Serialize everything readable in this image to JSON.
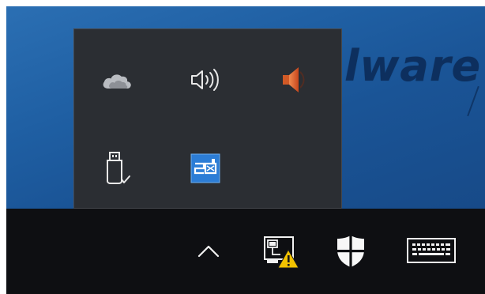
{
  "wallpaper": {
    "text": "lware"
  },
  "overflow_panel": {
    "icons": [
      {
        "name": "onedrive-cloud-icon",
        "row": 0,
        "col": 0
      },
      {
        "name": "speaker-volume-icon",
        "row": 0,
        "col": 1
      },
      {
        "name": "audio-app-speaker-icon",
        "row": 0,
        "col": 2
      },
      {
        "name": "usb-safely-remove-icon",
        "row": 1,
        "col": 0
      },
      {
        "name": "network-adapter-app-icon",
        "row": 1,
        "col": 1
      }
    ]
  },
  "taskbar": {
    "icons": [
      {
        "name": "show-hidden-icons-chevron-icon"
      },
      {
        "name": "network-warning-icon"
      },
      {
        "name": "windows-security-shield-icon"
      },
      {
        "name": "touch-keyboard-icon"
      }
    ]
  },
  "colors": {
    "panel_bg": "#2b2e33",
    "taskbar_bg": "#0e0f12",
    "wallpaper_blue": "#1f5fa3",
    "warning_yellow": "#f2c200",
    "speaker_orange": "#e0662e"
  }
}
